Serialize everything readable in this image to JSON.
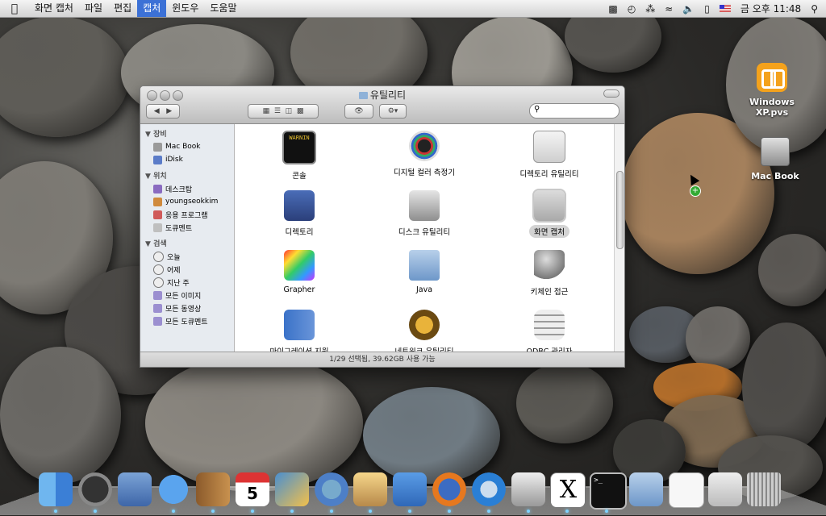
{
  "menubar": {
    "items": [
      "화면 캡처",
      "파일",
      "편집",
      "캡처",
      "윈도우",
      "도움말"
    ],
    "active_index": 3,
    "clock": "금 오후 11:48"
  },
  "desktop_icons": [
    {
      "label": "Windows XP.pvs",
      "icon": "parallels-icon"
    },
    {
      "label": "Mac Book",
      "icon": "hard-drive-icon"
    }
  ],
  "window": {
    "title": "유틸리티",
    "status": "1/29 선택됨, 39.62GB 사용 가능",
    "sidebar": {
      "devices_header": "장비",
      "devices": [
        "Mac Book",
        "iDisk"
      ],
      "places_header": "위치",
      "places": [
        "데스크탑",
        "youngseokkim",
        "응용 프로그램",
        "도큐멘트"
      ],
      "search_header": "검색",
      "search": [
        "오늘",
        "어제",
        "지난 주",
        "모든 이미지",
        "모든 동영상",
        "모든 도큐멘트"
      ]
    },
    "items": [
      {
        "label": "콘솔",
        "icon": "console-icon"
      },
      {
        "label": "디지털 컬러 측정기",
        "icon": "color-meter-icon"
      },
      {
        "label": "디렉토리 유틸리티",
        "icon": "directory-utility-icon"
      },
      {
        "label": "디렉토리",
        "icon": "directory-icon"
      },
      {
        "label": "디스크 유틸리티",
        "icon": "disk-utility-icon"
      },
      {
        "label": "화면 캡처",
        "icon": "grab-icon"
      },
      {
        "label": "Grapher",
        "icon": "grapher-icon"
      },
      {
        "label": "Java",
        "icon": "folder-icon"
      },
      {
        "label": "키체인 접근",
        "icon": "keychain-icon"
      },
      {
        "label": "마이그레이션 지원",
        "icon": "migration-icon"
      },
      {
        "label": "네트워크 유틸리티",
        "icon": "network-utility-icon"
      },
      {
        "label": "ODBC 관리자",
        "icon": "odbc-icon"
      }
    ],
    "selected_index": 5
  },
  "dock": [
    "finder-icon",
    "dashboard-icon",
    "mail-icon",
    "ichat-icon",
    "address-book-icon",
    "ical-icon",
    "iphoto-icon",
    "itunes-icon",
    "preview-icon",
    "safari-icon",
    "firefox-icon",
    "quicktime-icon",
    "grab-icon",
    "x11-icon",
    "terminal-icon",
    "folder-icon",
    "document-icon",
    "downloads-icon",
    "trash-icon"
  ],
  "dock_calendar_day": "5",
  "colors": {
    "menu_active": "#3c71d6",
    "selection": "#d3d3d3"
  }
}
